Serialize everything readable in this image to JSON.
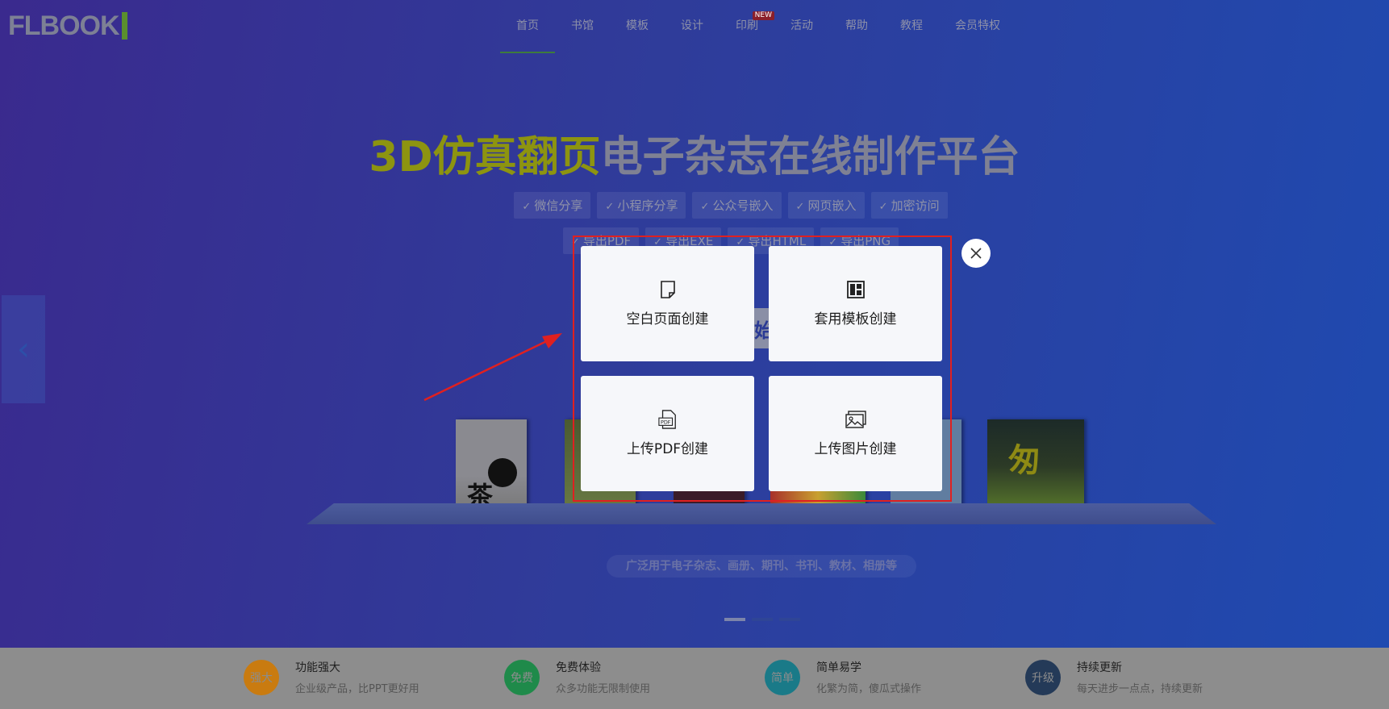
{
  "logo": {
    "text": "FLBOOK"
  },
  "nav": {
    "items": [
      {
        "label": "首页"
      },
      {
        "label": "书馆"
      },
      {
        "label": "模板"
      },
      {
        "label": "设计"
      },
      {
        "label": "印刷",
        "badge": "NEW"
      },
      {
        "label": "活动"
      },
      {
        "label": "帮助"
      },
      {
        "label": "教程"
      },
      {
        "label": "会员特权"
      }
    ]
  },
  "hero": {
    "title_highlight": "3D仿真翻页",
    "title_rest": "电子杂志在线制作平台",
    "tags_row1": [
      "微信分享",
      "小程序分享",
      "公众号嵌入",
      "网页嵌入",
      "加密访问"
    ],
    "tags_row2": [
      "导出PDF",
      "导出EXE",
      "导出HTML",
      "导出PNG"
    ],
    "start_button": "始",
    "subtitle": "广泛用于电子杂志、画册、期刊、书刊、教材、相册等",
    "books": {
      "b1_char": "茶",
      "b6_char": "匆"
    }
  },
  "modal": {
    "options": [
      {
        "label": "空白页面创建",
        "icon": "blank-page-icon"
      },
      {
        "label": "套用模板创建",
        "icon": "template-grid-icon"
      },
      {
        "label": "上传PDF创建",
        "icon": "pdf-file-icon"
      },
      {
        "label": "上传图片创建",
        "icon": "image-icon"
      }
    ],
    "close_icon": "close-icon",
    "highlight_color": "#e02020"
  },
  "features": [
    {
      "badge": "强大",
      "title": "功能强大",
      "desc": "企业级产品，比PPT更好用",
      "color": "#c97b10"
    },
    {
      "badge": "免费",
      "title": "免费体验",
      "desc": "众多功能无限制使用",
      "color": "#1f8a4a"
    },
    {
      "badge": "简单",
      "title": "简单易学",
      "desc": "化繁为简，傻瓜式操作",
      "color": "#1a7a88"
    },
    {
      "badge": "升级",
      "title": "持续更新",
      "desc": "每天进步一点点，持续更新",
      "color": "#243a58"
    }
  ]
}
